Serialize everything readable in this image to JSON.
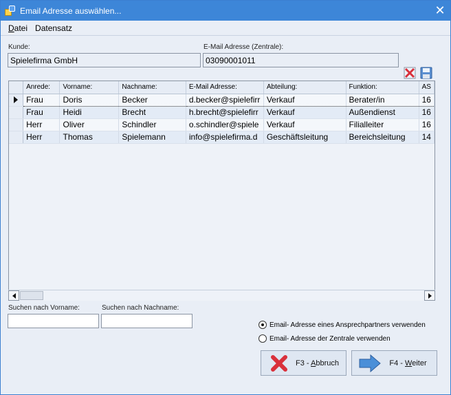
{
  "window": {
    "title": "Email Adresse auswählen..."
  },
  "menu": [
    {
      "label": "Datei",
      "accel": "D",
      "rest": "atei"
    },
    {
      "label": "Datensatz",
      "accel": "",
      "rest": "Datensatz"
    }
  ],
  "customer": {
    "label": "Kunde:",
    "value": "Spielefirma GmbH"
  },
  "central_email": {
    "label": "E-Mail Adresse (Zentrale):",
    "value": "03090001011"
  },
  "grid": {
    "columns": [
      "Anrede:",
      "Vorname:",
      "Nachname:",
      "E-Mail Adresse:",
      "Abteilung:",
      "Funktion:",
      "AS"
    ],
    "rows": [
      [
        "Frau",
        "Doris",
        "Becker",
        "d.becker@spielefirr",
        "Verkauf",
        "Berater/in",
        "16"
      ],
      [
        "Frau",
        "Heidi",
        "Brecht",
        "h.brecht@spielefirr",
        "Verkauf",
        "Außendienst",
        "16"
      ],
      [
        "Herr",
        "Oliver",
        "Schindler",
        "o.schindler@spiele",
        "Verkauf",
        "Filialleiter",
        "16"
      ],
      [
        "Herr",
        "Thomas",
        "Spielemann",
        "info@spielefirma.d",
        "Geschäftsleitung",
        "Bereichsleitung",
        "14"
      ]
    ],
    "current_row": 0
  },
  "search": {
    "first_name_label": "Suchen nach Vorname:",
    "first_name_value": "",
    "last_name_label": "Suchen nach Nachname:",
    "last_name_value": ""
  },
  "options": {
    "contact_label": "Email- Adresse eines Ansprechpartners verwenden",
    "central_label": "Email- Adresse der Zentrale verwenden",
    "selected": "contact"
  },
  "buttons": {
    "cancel": {
      "pre": "F3 - ",
      "accel": "A",
      "post": "bbruch"
    },
    "next": {
      "pre": "F4 - ",
      "accel": "W",
      "post": "eiter"
    }
  },
  "colors": {
    "titlebar": "#3d86d8",
    "window_bg": "#e9eef6",
    "cancel_icon": "#d9303b",
    "next_icon": "#4a8fd8"
  }
}
